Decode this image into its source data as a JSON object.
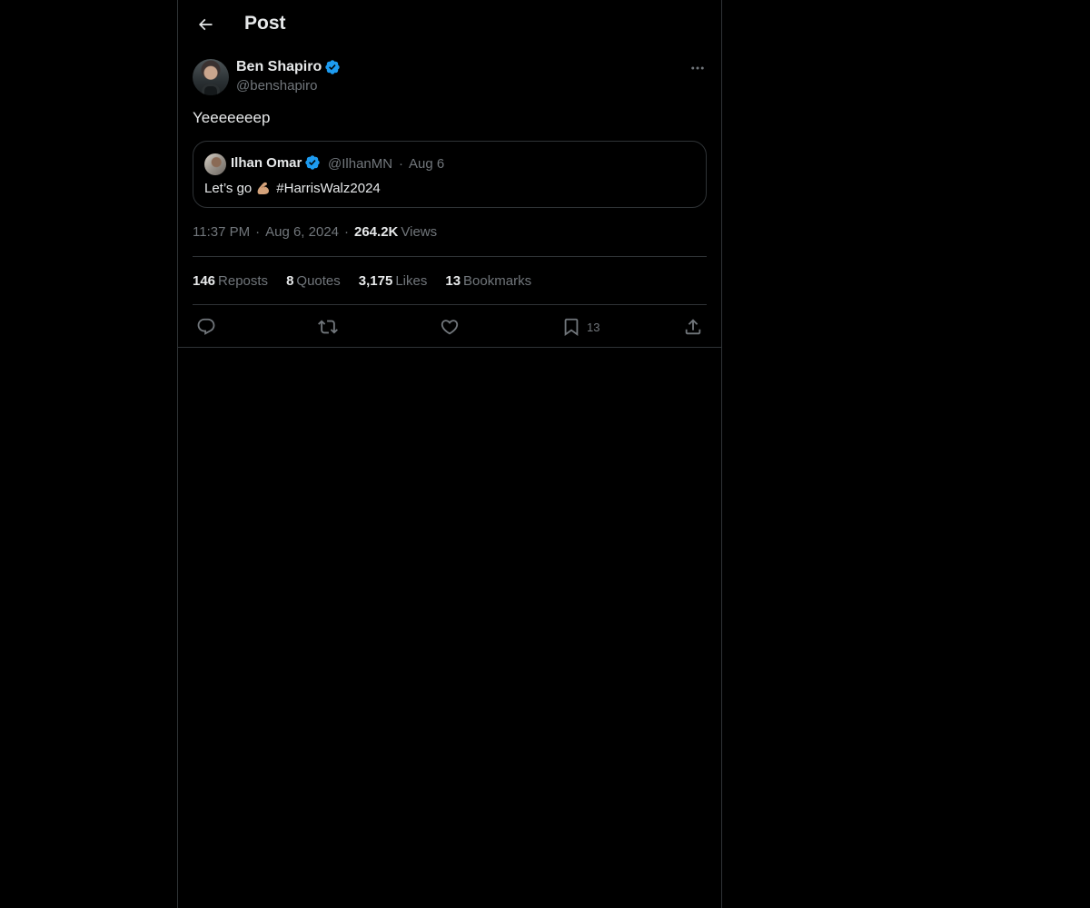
{
  "header": {
    "title": "Post",
    "back_icon": "arrow-left-icon"
  },
  "post": {
    "author": {
      "name": "Ben Shapiro",
      "handle": "@benshapiro",
      "verified": true
    },
    "text": "Yeeeeeeep",
    "quote": {
      "author_name": "Ilhan Omar",
      "handle": "@IlhanMN",
      "separator": "·",
      "date": "Aug 6",
      "text_before": "Let’s go",
      "emoji": "flexed-biceps-icon",
      "hashtag": "#HarrisWalz2024"
    },
    "meta": {
      "time": "11:37 PM",
      "separator": "·",
      "date": "Aug 6, 2024",
      "views_count": "264.2K",
      "views_label": "Views"
    },
    "stats": {
      "reposts_count": "146",
      "reposts_label": "Reposts",
      "quotes_count": "8",
      "quotes_label": "Quotes",
      "likes_count": "3,175",
      "likes_label": "Likes",
      "bookmarks_count": "13",
      "bookmarks_label": "Bookmarks"
    },
    "actions": {
      "bookmark_count": "13"
    }
  },
  "colors": {
    "background": "#000000",
    "text_primary": "#e7e9ea",
    "text_secondary": "#71767b",
    "border": "#2f3336",
    "verified_blue": "#1d9bf0"
  }
}
